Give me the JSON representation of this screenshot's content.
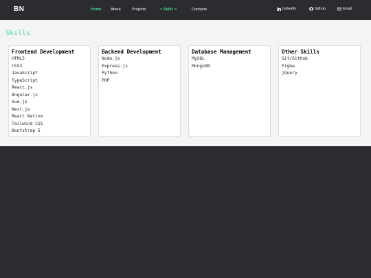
{
  "header": {
    "logo": "BN",
    "nav": [
      {
        "label": "Home"
      },
      {
        "label": "About"
      },
      {
        "label": "Projects"
      },
      {
        "label": "< Skills >"
      },
      {
        "label": "Contacts"
      }
    ],
    "social": [
      {
        "label": "LinkedIn",
        "icon": "linkedin-icon"
      },
      {
        "label": "Github",
        "icon": "github-icon"
      },
      {
        "label": "Email",
        "icon": "envelope-icon"
      }
    ]
  },
  "skills": {
    "title": "Skills",
    "cards": [
      {
        "title": "Frontend Development",
        "items": [
          "HTML5",
          "CSS3",
          "JavaScript",
          "TypeScript",
          "React.js",
          "Angular.js",
          "Vue.js",
          "Next.js",
          "React Native",
          "Tailwind CSS",
          "Bootstrap 5"
        ]
      },
      {
        "title": "Backend Development",
        "items": [
          "Node.js",
          "Express.js",
          "Python",
          "PHP"
        ]
      },
      {
        "title": "Database Management",
        "items": [
          "MySQL",
          "MongoDB"
        ]
      },
      {
        "title": "Other Skills",
        "items": [
          "Git/GitHub",
          "Figma",
          "jQuery"
        ]
      }
    ]
  },
  "colors": {
    "accent": "#4ddb9c",
    "header_bg": "#2b2c2f",
    "content_bg": "#f4f4f4"
  }
}
